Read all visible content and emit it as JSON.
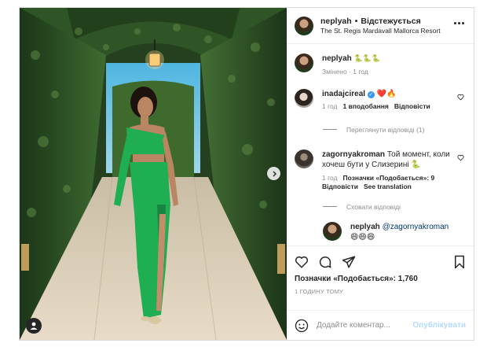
{
  "post": {
    "username": "neplyah",
    "separator": "•",
    "follow_status": "Відстежується",
    "location": "The St. Regis Mardavall Mallorca Resort",
    "caption": "🐍🐍🐍",
    "caption_meta": "Змінено · 1 год"
  },
  "comments": [
    {
      "username": "inadajcireal",
      "verified": true,
      "text": "❤️🔥",
      "time": "1 год",
      "likes": "1 вподобання",
      "reply": "Відповісти",
      "view_replies": "Переглянути відповіді (1)"
    },
    {
      "username": "zagornyakroman",
      "text": "Той момент, коли хочеш бути у Слизерині 🐍",
      "time": "1 год",
      "likes": "Позначки «Подобається»: 9",
      "reply": "Відповісти",
      "translate": "See translation",
      "hide_replies": "Сховати відповіді"
    },
    {
      "username": "neplyah",
      "text": "@zagornyakroman",
      "emoji": "😄😄😄"
    }
  ],
  "actions": {
    "likes_line": "Позначки «Подобається»: 1,760",
    "timestamp": "1 ГОДИНУ ТОМУ"
  },
  "composer": {
    "placeholder": "Додайте коментар...",
    "publish_label": "Опублікувати"
  },
  "colors": {
    "accent_blue": "#0095f6",
    "publish_disabled": "#b3dbff",
    "dress_green": "#1fae52"
  }
}
